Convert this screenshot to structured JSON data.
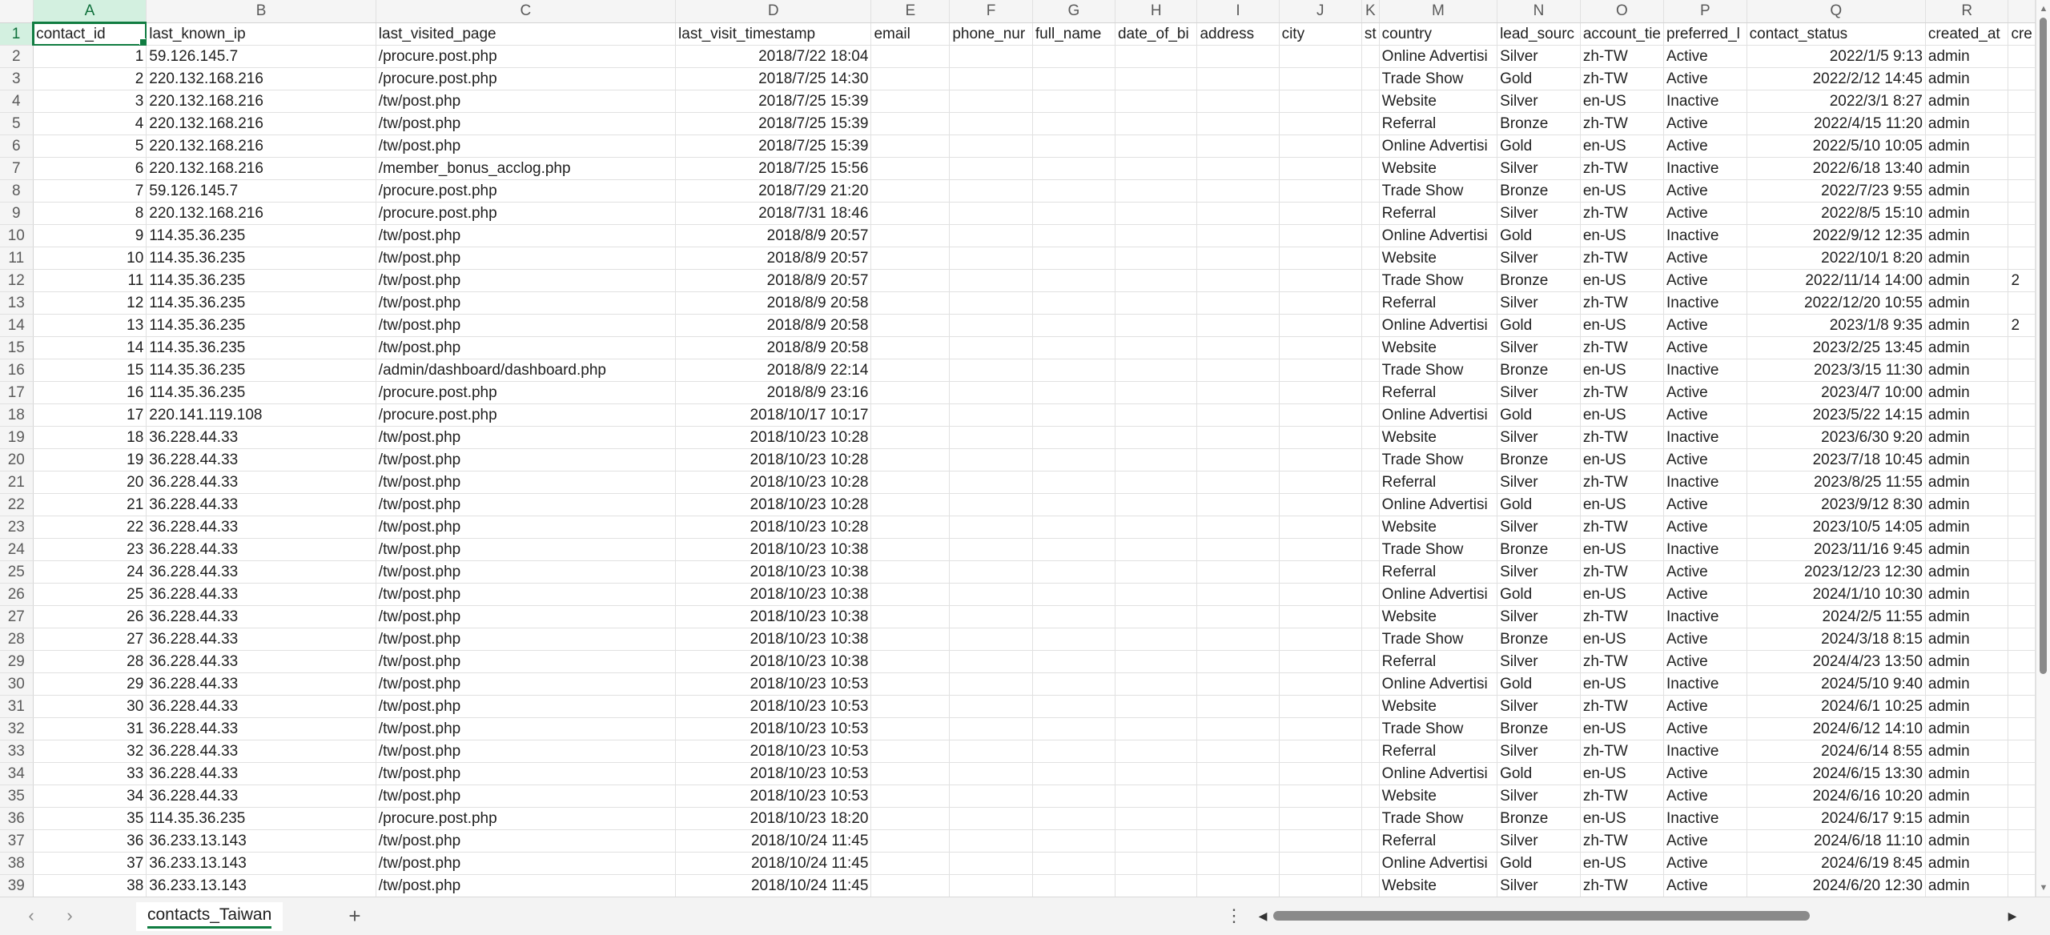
{
  "columns": [
    {
      "letter": "A",
      "header": "contact_id"
    },
    {
      "letter": "B",
      "header": "last_known_ip"
    },
    {
      "letter": "C",
      "header": "last_visited_page"
    },
    {
      "letter": "D",
      "header": "last_visit_timestamp"
    },
    {
      "letter": "E",
      "header": "email"
    },
    {
      "letter": "F",
      "header": "phone_nur"
    },
    {
      "letter": "G",
      "header": "full_name"
    },
    {
      "letter": "H",
      "header": "date_of_bi"
    },
    {
      "letter": "I",
      "header": "address"
    },
    {
      "letter": "J",
      "header": "city"
    },
    {
      "letter": "K",
      "header": "st"
    },
    {
      "letter": "M",
      "header": "country"
    },
    {
      "letter": "N",
      "header": "lead_sourc"
    },
    {
      "letter": "O",
      "header": "account_tie"
    },
    {
      "letter": "P",
      "header": "preferred_l"
    },
    {
      "letter": "Q",
      "header": "contact_status"
    },
    {
      "letter": "R",
      "header": "created_at"
    },
    {
      "letter": "",
      "header": "cre"
    }
  ],
  "rows": [
    [
      "1",
      "59.126.145.7",
      "/procure.post.php",
      "2018/7/22 18:04",
      "",
      "",
      "",
      "",
      "",
      "",
      "",
      "Online Advertisi",
      "Silver",
      "zh-TW",
      "Active",
      "2022/1/5 9:13",
      "admin",
      ""
    ],
    [
      "2",
      "220.132.168.216",
      "/procure.post.php",
      "2018/7/25 14:30",
      "",
      "",
      "",
      "",
      "",
      "",
      "",
      "Trade Show",
      "Gold",
      "zh-TW",
      "Active",
      "2022/2/12 14:45",
      "admin",
      ""
    ],
    [
      "3",
      "220.132.168.216",
      "/tw/post.php",
      "2018/7/25 15:39",
      "",
      "",
      "",
      "",
      "",
      "",
      "",
      "Website",
      "Silver",
      "en-US",
      "Inactive",
      "2022/3/1 8:27",
      "admin",
      ""
    ],
    [
      "4",
      "220.132.168.216",
      "/tw/post.php",
      "2018/7/25 15:39",
      "",
      "",
      "",
      "",
      "",
      "",
      "",
      "Referral",
      "Bronze",
      "zh-TW",
      "Active",
      "2022/4/15 11:20",
      "admin",
      ""
    ],
    [
      "5",
      "220.132.168.216",
      "/tw/post.php",
      "2018/7/25 15:39",
      "",
      "",
      "",
      "",
      "",
      "",
      "",
      "Online Advertisi",
      "Gold",
      "en-US",
      "Active",
      "2022/5/10 10:05",
      "admin",
      ""
    ],
    [
      "6",
      "220.132.168.216",
      "/member_bonus_acclog.php",
      "2018/7/25 15:56",
      "",
      "",
      "",
      "",
      "",
      "",
      "",
      "Website",
      "Silver",
      "zh-TW",
      "Inactive",
      "2022/6/18 13:40",
      "admin",
      ""
    ],
    [
      "7",
      "59.126.145.7",
      "/procure.post.php",
      "2018/7/29 21:20",
      "",
      "",
      "",
      "",
      "",
      "",
      "",
      "Trade Show",
      "Bronze",
      "en-US",
      "Active",
      "2022/7/23 9:55",
      "admin",
      ""
    ],
    [
      "8",
      "220.132.168.216",
      "/procure.post.php",
      "2018/7/31 18:46",
      "",
      "",
      "",
      "",
      "",
      "",
      "",
      "Referral",
      "Silver",
      "zh-TW",
      "Active",
      "2022/8/5 15:10",
      "admin",
      ""
    ],
    [
      "9",
      "114.35.36.235",
      "/tw/post.php",
      "2018/8/9 20:57",
      "",
      "",
      "",
      "",
      "",
      "",
      "",
      "Online Advertisi",
      "Gold",
      "en-US",
      "Inactive",
      "2022/9/12 12:35",
      "admin",
      ""
    ],
    [
      "10",
      "114.35.36.235",
      "/tw/post.php",
      "2018/8/9 20:57",
      "",
      "",
      "",
      "",
      "",
      "",
      "",
      "Website",
      "Silver",
      "zh-TW",
      "Active",
      "2022/10/1 8:20",
      "admin",
      ""
    ],
    [
      "11",
      "114.35.36.235",
      "/tw/post.php",
      "2018/8/9 20:57",
      "",
      "",
      "",
      "",
      "",
      "",
      "",
      "Trade Show",
      "Bronze",
      "en-US",
      "Active",
      "2022/11/14 14:00",
      "admin",
      "2"
    ],
    [
      "12",
      "114.35.36.235",
      "/tw/post.php",
      "2018/8/9 20:58",
      "",
      "",
      "",
      "",
      "",
      "",
      "",
      "Referral",
      "Silver",
      "zh-TW",
      "Inactive",
      "2022/12/20 10:55",
      "admin",
      ""
    ],
    [
      "13",
      "114.35.36.235",
      "/tw/post.php",
      "2018/8/9 20:58",
      "",
      "",
      "",
      "",
      "",
      "",
      "",
      "Online Advertisi",
      "Gold",
      "en-US",
      "Active",
      "2023/1/8 9:35",
      "admin",
      "2"
    ],
    [
      "14",
      "114.35.36.235",
      "/tw/post.php",
      "2018/8/9 20:58",
      "",
      "",
      "",
      "",
      "",
      "",
      "",
      "Website",
      "Silver",
      "zh-TW",
      "Active",
      "2023/2/25 13:45",
      "admin",
      ""
    ],
    [
      "15",
      "114.35.36.235",
      "/admin/dashboard/dashboard.php",
      "2018/8/9 22:14",
      "",
      "",
      "",
      "",
      "",
      "",
      "",
      "Trade Show",
      "Bronze",
      "en-US",
      "Inactive",
      "2023/3/15 11:30",
      "admin",
      ""
    ],
    [
      "16",
      "114.35.36.235",
      "/procure.post.php",
      "2018/8/9 23:16",
      "",
      "",
      "",
      "",
      "",
      "",
      "",
      "Referral",
      "Silver",
      "zh-TW",
      "Active",
      "2023/4/7 10:00",
      "admin",
      ""
    ],
    [
      "17",
      "220.141.119.108",
      "/procure.post.php",
      "2018/10/17 10:17",
      "",
      "",
      "",
      "",
      "",
      "",
      "",
      "Online Advertisi",
      "Gold",
      "en-US",
      "Active",
      "2023/5/22 14:15",
      "admin",
      ""
    ],
    [
      "18",
      "36.228.44.33",
      "/tw/post.php",
      "2018/10/23 10:28",
      "",
      "",
      "",
      "",
      "",
      "",
      "",
      "Website",
      "Silver",
      "zh-TW",
      "Inactive",
      "2023/6/30 9:20",
      "admin",
      ""
    ],
    [
      "19",
      "36.228.44.33",
      "/tw/post.php",
      "2018/10/23 10:28",
      "",
      "",
      "",
      "",
      "",
      "",
      "",
      "Trade Show",
      "Bronze",
      "en-US",
      "Active",
      "2023/7/18 10:45",
      "admin",
      ""
    ],
    [
      "20",
      "36.228.44.33",
      "/tw/post.php",
      "2018/10/23 10:28",
      "",
      "",
      "",
      "",
      "",
      "",
      "",
      "Referral",
      "Silver",
      "zh-TW",
      "Inactive",
      "2023/8/25 11:55",
      "admin",
      ""
    ],
    [
      "21",
      "36.228.44.33",
      "/tw/post.php",
      "2018/10/23 10:28",
      "",
      "",
      "",
      "",
      "",
      "",
      "",
      "Online Advertisi",
      "Gold",
      "en-US",
      "Active",
      "2023/9/12 8:30",
      "admin",
      ""
    ],
    [
      "22",
      "36.228.44.33",
      "/tw/post.php",
      "2018/10/23 10:28",
      "",
      "",
      "",
      "",
      "",
      "",
      "",
      "Website",
      "Silver",
      "zh-TW",
      "Active",
      "2023/10/5 14:05",
      "admin",
      ""
    ],
    [
      "23",
      "36.228.44.33",
      "/tw/post.php",
      "2018/10/23 10:38",
      "",
      "",
      "",
      "",
      "",
      "",
      "",
      "Trade Show",
      "Bronze",
      "en-US",
      "Inactive",
      "2023/11/16 9:45",
      "admin",
      ""
    ],
    [
      "24",
      "36.228.44.33",
      "/tw/post.php",
      "2018/10/23 10:38",
      "",
      "",
      "",
      "",
      "",
      "",
      "",
      "Referral",
      "Silver",
      "zh-TW",
      "Active",
      "2023/12/23 12:30",
      "admin",
      ""
    ],
    [
      "25",
      "36.228.44.33",
      "/tw/post.php",
      "2018/10/23 10:38",
      "",
      "",
      "",
      "",
      "",
      "",
      "",
      "Online Advertisi",
      "Gold",
      "en-US",
      "Active",
      "2024/1/10 10:30",
      "admin",
      ""
    ],
    [
      "26",
      "36.228.44.33",
      "/tw/post.php",
      "2018/10/23 10:38",
      "",
      "",
      "",
      "",
      "",
      "",
      "",
      "Website",
      "Silver",
      "zh-TW",
      "Inactive",
      "2024/2/5 11:55",
      "admin",
      ""
    ],
    [
      "27",
      "36.228.44.33",
      "/tw/post.php",
      "2018/10/23 10:38",
      "",
      "",
      "",
      "",
      "",
      "",
      "",
      "Trade Show",
      "Bronze",
      "en-US",
      "Active",
      "2024/3/18 8:15",
      "admin",
      ""
    ],
    [
      "28",
      "36.228.44.33",
      "/tw/post.php",
      "2018/10/23 10:38",
      "",
      "",
      "",
      "",
      "",
      "",
      "",
      "Referral",
      "Silver",
      "zh-TW",
      "Active",
      "2024/4/23 13:50",
      "admin",
      ""
    ],
    [
      "29",
      "36.228.44.33",
      "/tw/post.php",
      "2018/10/23 10:53",
      "",
      "",
      "",
      "",
      "",
      "",
      "",
      "Online Advertisi",
      "Gold",
      "en-US",
      "Inactive",
      "2024/5/10 9:40",
      "admin",
      ""
    ],
    [
      "30",
      "36.228.44.33",
      "/tw/post.php",
      "2018/10/23 10:53",
      "",
      "",
      "",
      "",
      "",
      "",
      "",
      "Website",
      "Silver",
      "zh-TW",
      "Active",
      "2024/6/1 10:25",
      "admin",
      ""
    ],
    [
      "31",
      "36.228.44.33",
      "/tw/post.php",
      "2018/10/23 10:53",
      "",
      "",
      "",
      "",
      "",
      "",
      "",
      "Trade Show",
      "Bronze",
      "en-US",
      "Active",
      "2024/6/12 14:10",
      "admin",
      ""
    ],
    [
      "32",
      "36.228.44.33",
      "/tw/post.php",
      "2018/10/23 10:53",
      "",
      "",
      "",
      "",
      "",
      "",
      "",
      "Referral",
      "Silver",
      "zh-TW",
      "Inactive",
      "2024/6/14 8:55",
      "admin",
      ""
    ],
    [
      "33",
      "36.228.44.33",
      "/tw/post.php",
      "2018/10/23 10:53",
      "",
      "",
      "",
      "",
      "",
      "",
      "",
      "Online Advertisi",
      "Gold",
      "en-US",
      "Active",
      "2024/6/15 13:30",
      "admin",
      ""
    ],
    [
      "34",
      "36.228.44.33",
      "/tw/post.php",
      "2018/10/23 10:53",
      "",
      "",
      "",
      "",
      "",
      "",
      "",
      "Website",
      "Silver",
      "zh-TW",
      "Active",
      "2024/6/16 10:20",
      "admin",
      ""
    ],
    [
      "35",
      "114.35.36.235",
      "/procure.post.php",
      "2018/10/23 18:20",
      "",
      "",
      "",
      "",
      "",
      "",
      "",
      "Trade Show",
      "Bronze",
      "en-US",
      "Inactive",
      "2024/6/17 9:15",
      "admin",
      ""
    ],
    [
      "36",
      "36.233.13.143",
      "/tw/post.php",
      "2018/10/24 11:45",
      "",
      "",
      "",
      "",
      "",
      "",
      "",
      "Referral",
      "Silver",
      "zh-TW",
      "Active",
      "2024/6/18 11:10",
      "admin",
      ""
    ],
    [
      "37",
      "36.233.13.143",
      "/tw/post.php",
      "2018/10/24 11:45",
      "",
      "",
      "",
      "",
      "",
      "",
      "",
      "Online Advertisi",
      "Gold",
      "en-US",
      "Active",
      "2024/6/19 8:45",
      "admin",
      ""
    ],
    [
      "38",
      "36.233.13.143",
      "/tw/post.php",
      "2018/10/24 11:45",
      "",
      "",
      "",
      "",
      "",
      "",
      "",
      "Website",
      "Silver",
      "zh-TW",
      "Active",
      "2024/6/20 12:30",
      "admin",
      ""
    ]
  ],
  "sheet_tabs": [
    {
      "label": "contacts_Taiwan"
    }
  ],
  "icons": {
    "prev_sheet": "chevron-left-icon",
    "next_sheet": "chevron-right-icon",
    "add_sheet": "plus-icon",
    "more": "more-vertical-icon"
  },
  "colors": {
    "accent": "#107c41",
    "header_bg": "#f5f5f5",
    "grid": "#e1e1e1"
  }
}
